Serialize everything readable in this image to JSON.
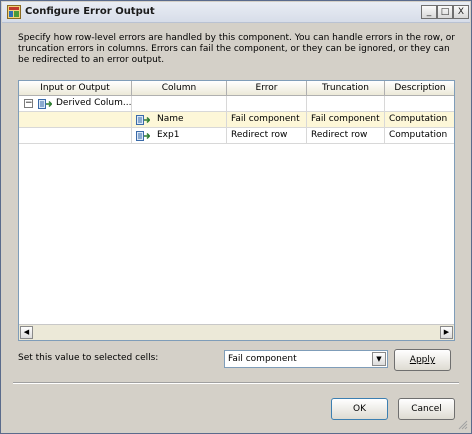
{
  "window": {
    "title": "Configure Error Output",
    "controls": {
      "minimize": "_",
      "maximize": "□",
      "close": "X"
    }
  },
  "description": "Specify how row-level errors are handled by this component. You can handle errors in the row, or truncation errors in columns. Errors can fail the component, or they can be ignored, or they can be redirected to an error output.",
  "grid": {
    "columns": [
      "Input or Output",
      "Column",
      "Error",
      "Truncation",
      "Description"
    ],
    "rows": [
      {
        "input_or_output": "Derived Colum...",
        "column": "",
        "error": "",
        "truncation": "",
        "description": "",
        "expander": "−",
        "icon": "derived-column-icon"
      },
      {
        "input_or_output": "",
        "column": "Name",
        "error": "Fail component",
        "truncation": "Fail component",
        "description": "Computation",
        "icon": "column-icon",
        "selected": true
      },
      {
        "input_or_output": "",
        "column": "Exp1",
        "error": "Redirect row",
        "truncation": "Redirect row",
        "description": "Computation",
        "icon": "column-icon"
      }
    ],
    "scroll_left": "◀",
    "scroll_right": "▶"
  },
  "set_value": {
    "label": "Set this value to selected cells:",
    "selected": "Fail component",
    "dropdown_arrow": "▼",
    "apply_label": "Apply"
  },
  "buttons": {
    "ok": "OK",
    "cancel": "Cancel"
  },
  "colors": {
    "selected_row": "#fdf7d8",
    "dialog_bg": "#d4d0c8",
    "grid_border": "#7f9db9"
  }
}
